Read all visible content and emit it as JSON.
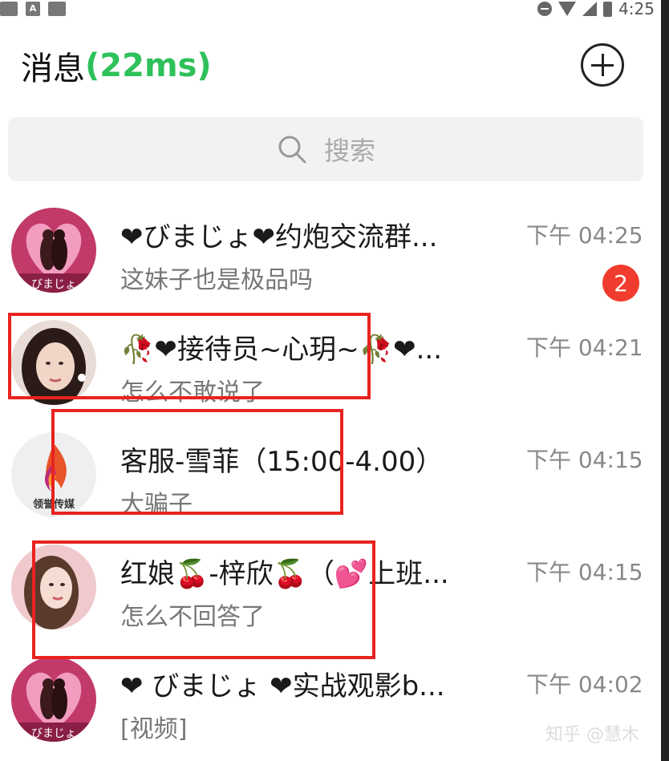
{
  "status_bar": {
    "time": "4:25",
    "icons": [
      "app-icon",
      "a-icon",
      "app-icon",
      "dnd-icon",
      "wifi-icon",
      "signal-icon",
      "battery-icon"
    ]
  },
  "header": {
    "title": "消息",
    "latency": "(22ms)",
    "add_icon": "plus-circle-icon"
  },
  "search": {
    "placeholder": "搜索",
    "icon": "search-icon"
  },
  "chats": [
    {
      "name": "❤びまじょ❤约炮交流群...",
      "preview": "这妹子也是极品吗",
      "time": "下午 04:25",
      "badge": "2"
    },
    {
      "name": "🥀❤接待员~心玥~🥀❤...",
      "preview": "怎么不敢说了",
      "time": "下午 04:21"
    },
    {
      "name": "客服-雪菲（15:00-4.00）",
      "preview": "大骗子",
      "time": "下午 04:15"
    },
    {
      "name": "红娘🍒-梓欣🍒（💕上班...",
      "preview": "怎么不回答了",
      "time": "下午 04:15"
    },
    {
      "name": "❤ びまじょ ❤实战观影b...",
      "preview": "[视频]",
      "time": "下午 04:02"
    }
  ],
  "avatar_text": {
    "brand": "领誉传媒",
    "bimajo": "びまじょ"
  },
  "colors": {
    "accent_green": "#2ec15a",
    "badge_red": "#f03c2e",
    "highlight_red": "#e8231f"
  },
  "watermark": "知乎 @慧木"
}
